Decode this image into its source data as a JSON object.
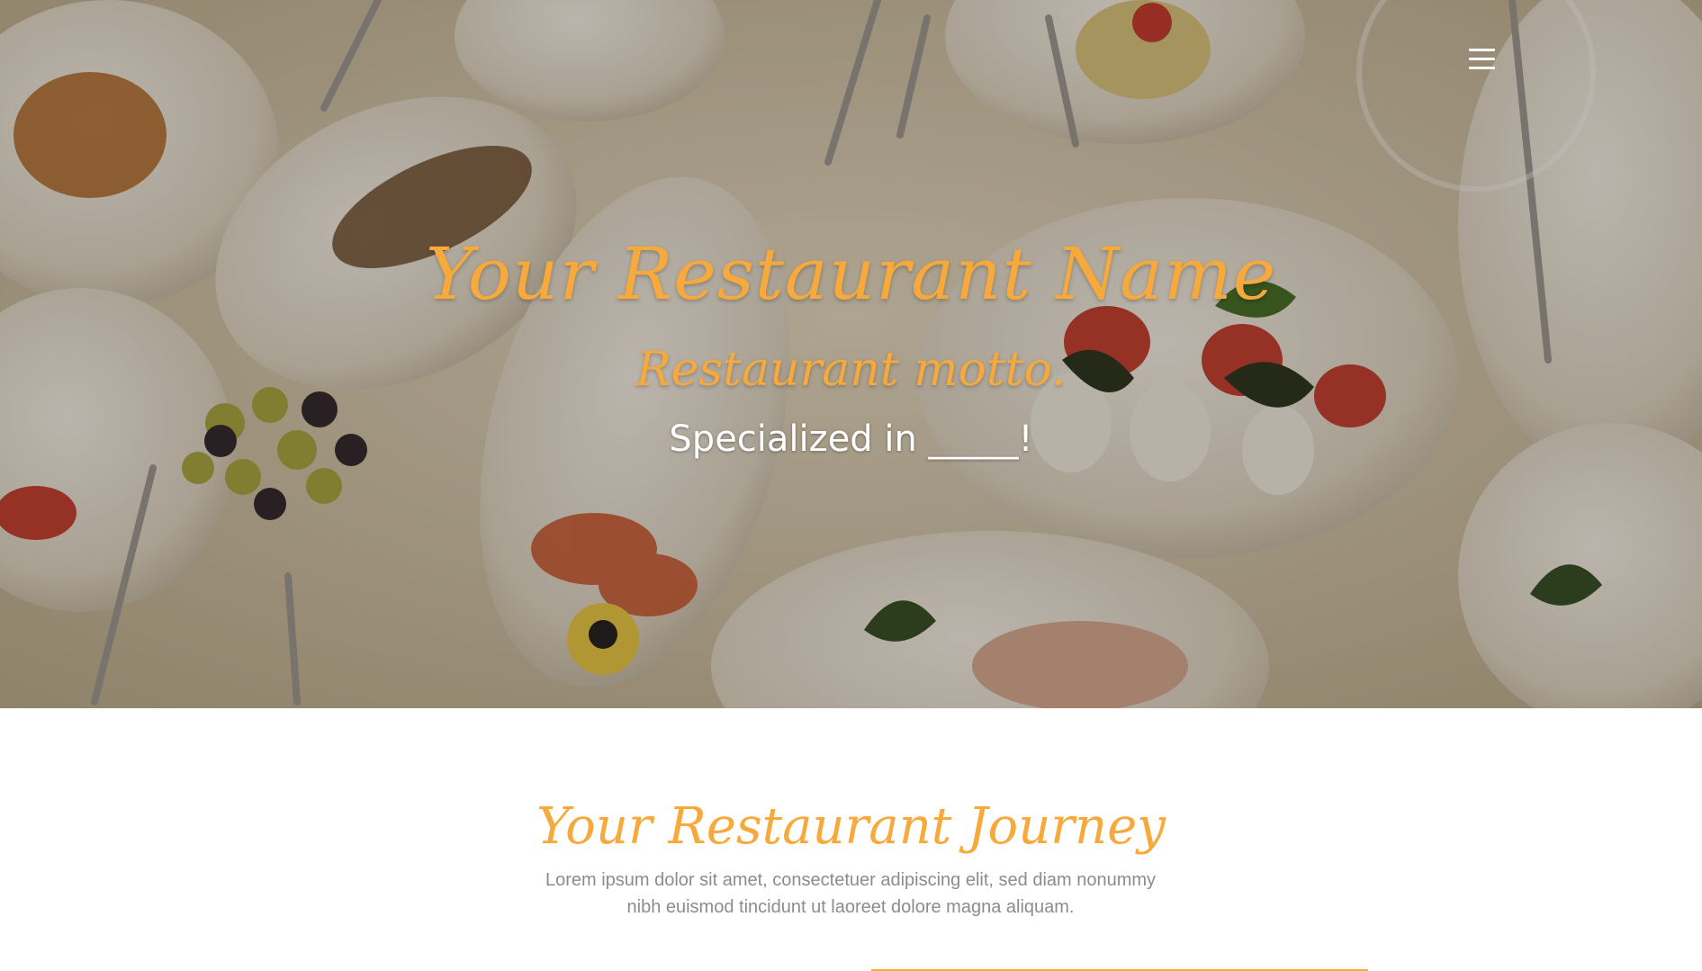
{
  "header": {
    "menu_icon": "hamburger-menu-icon"
  },
  "hero": {
    "title": "Your Restaurant Name",
    "motto": "Restaurant motto.",
    "specialized": "Specialized in _____!"
  },
  "journey": {
    "title": "Your Restaurant Journey",
    "text": "Lorem ipsum dolor sit amet, consectetuer adipiscing elit, sed diam nonummy nibh euismod tincidunt ut laoreet dolore magna aliquam."
  },
  "colors": {
    "accent": "#f7a93b",
    "body_text": "#8c8c8c",
    "background": "#ffffff"
  }
}
